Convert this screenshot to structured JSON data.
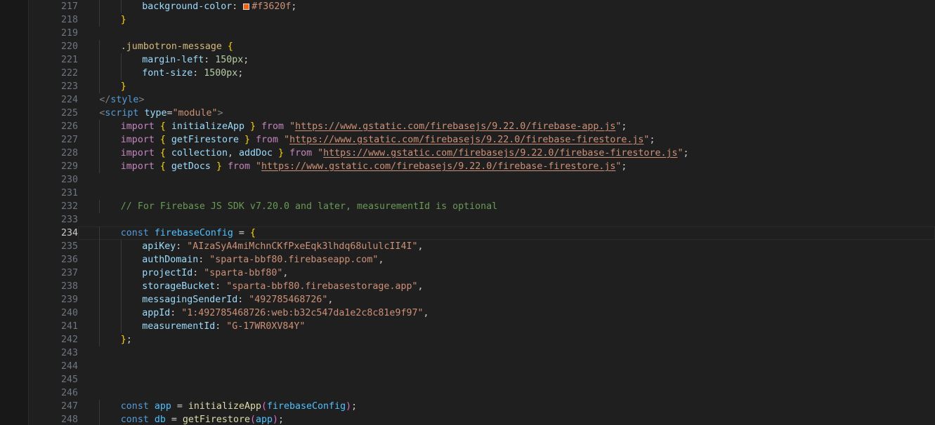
{
  "editor": {
    "active_line": 234,
    "color_swatch": "#f3620f",
    "lines": [
      {
        "num": 217,
        "indent": 3,
        "tokens": [
          [
            "tok-prop",
            "background-color"
          ],
          [
            "tok-plain",
            ": "
          ],
          [
            "swatch",
            ""
          ],
          [
            "tok-str",
            "#f3620f"
          ],
          [
            "tok-plain",
            ";"
          ]
        ]
      },
      {
        "num": 218,
        "indent": 2,
        "tokens": [
          [
            "tok-brace",
            "}"
          ]
        ]
      },
      {
        "num": 219,
        "indent": 0,
        "tokens": []
      },
      {
        "num": 220,
        "indent": 2,
        "tokens": [
          [
            "tok-sel",
            ".jumbotron-message"
          ],
          [
            "tok-plain",
            " "
          ],
          [
            "tok-brace",
            "{"
          ]
        ]
      },
      {
        "num": 221,
        "indent": 3,
        "tokens": [
          [
            "tok-prop",
            "margin-left"
          ],
          [
            "tok-plain",
            ": "
          ],
          [
            "tok-num",
            "150px"
          ],
          [
            "tok-plain",
            ";"
          ]
        ]
      },
      {
        "num": 222,
        "indent": 3,
        "tokens": [
          [
            "tok-prop",
            "font-size"
          ],
          [
            "tok-plain",
            ": "
          ],
          [
            "tok-num",
            "1500px"
          ],
          [
            "tok-plain",
            ";"
          ]
        ]
      },
      {
        "num": 223,
        "indent": 2,
        "tokens": [
          [
            "tok-brace",
            "}"
          ]
        ]
      },
      {
        "num": 224,
        "indent": 1,
        "tokens": [
          [
            "tok-punct",
            "</"
          ],
          [
            "tok-tag",
            "style"
          ],
          [
            "tok-punct",
            ">"
          ]
        ]
      },
      {
        "num": 225,
        "indent": 1,
        "tokens": [
          [
            "tok-punct",
            "<"
          ],
          [
            "tok-tag",
            "script"
          ],
          [
            "tok-plain",
            " "
          ],
          [
            "tok-attr",
            "type"
          ],
          [
            "tok-plain",
            "="
          ],
          [
            "tok-str",
            "\"module\""
          ],
          [
            "tok-punct",
            ">"
          ]
        ]
      },
      {
        "num": 226,
        "indent": 2,
        "tokens": [
          [
            "tok-kw",
            "import"
          ],
          [
            "tok-plain",
            " "
          ],
          [
            "tok-brace",
            "{"
          ],
          [
            "tok-plain",
            " "
          ],
          [
            "tok-var",
            "initializeApp"
          ],
          [
            "tok-plain",
            " "
          ],
          [
            "tok-brace",
            "}"
          ],
          [
            "tok-plain",
            " "
          ],
          [
            "tok-kw",
            "from"
          ],
          [
            "tok-plain",
            " "
          ],
          [
            "tok-str",
            "\""
          ],
          [
            "tok-url",
            "https://www.gstatic.com/firebasejs/9.22.0/firebase-app.js"
          ],
          [
            "tok-str",
            "\""
          ],
          [
            "tok-plain",
            ";"
          ]
        ]
      },
      {
        "num": 227,
        "indent": 2,
        "tokens": [
          [
            "tok-kw",
            "import"
          ],
          [
            "tok-plain",
            " "
          ],
          [
            "tok-brace",
            "{"
          ],
          [
            "tok-plain",
            " "
          ],
          [
            "tok-var",
            "getFirestore"
          ],
          [
            "tok-plain",
            " "
          ],
          [
            "tok-brace",
            "}"
          ],
          [
            "tok-plain",
            " "
          ],
          [
            "tok-kw",
            "from"
          ],
          [
            "tok-plain",
            " "
          ],
          [
            "tok-str",
            "\""
          ],
          [
            "tok-url",
            "https://www.gstatic.com/firebasejs/9.22.0/firebase-firestore.js"
          ],
          [
            "tok-str",
            "\""
          ],
          [
            "tok-plain",
            ";"
          ]
        ]
      },
      {
        "num": 228,
        "indent": 2,
        "tokens": [
          [
            "tok-kw",
            "import"
          ],
          [
            "tok-plain",
            " "
          ],
          [
            "tok-brace",
            "{"
          ],
          [
            "tok-plain",
            " "
          ],
          [
            "tok-var",
            "collection"
          ],
          [
            "tok-plain",
            ", "
          ],
          [
            "tok-var",
            "addDoc"
          ],
          [
            "tok-plain",
            " "
          ],
          [
            "tok-brace",
            "}"
          ],
          [
            "tok-plain",
            " "
          ],
          [
            "tok-kw",
            "from"
          ],
          [
            "tok-plain",
            " "
          ],
          [
            "tok-str",
            "\""
          ],
          [
            "tok-url",
            "https://www.gstatic.com/firebasejs/9.22.0/firebase-firestore.js"
          ],
          [
            "tok-str",
            "\""
          ],
          [
            "tok-plain",
            ";"
          ]
        ]
      },
      {
        "num": 229,
        "indent": 2,
        "tokens": [
          [
            "tok-kw",
            "import"
          ],
          [
            "tok-plain",
            " "
          ],
          [
            "tok-brace",
            "{"
          ],
          [
            "tok-plain",
            " "
          ],
          [
            "tok-var",
            "getDocs"
          ],
          [
            "tok-plain",
            " "
          ],
          [
            "tok-brace",
            "}"
          ],
          [
            "tok-plain",
            " "
          ],
          [
            "tok-kw",
            "from"
          ],
          [
            "tok-plain",
            " "
          ],
          [
            "tok-str",
            "\""
          ],
          [
            "tok-url",
            "https://www.gstatic.com/firebasejs/9.22.0/firebase-firestore.js"
          ],
          [
            "tok-str",
            "\""
          ],
          [
            "tok-plain",
            ";"
          ]
        ]
      },
      {
        "num": 230,
        "indent": 0,
        "tokens": []
      },
      {
        "num": 231,
        "indent": 0,
        "tokens": []
      },
      {
        "num": 232,
        "indent": 2,
        "tokens": [
          [
            "tok-comment",
            "// For Firebase JS SDK v7.20.0 and later, measurementId is optional"
          ]
        ]
      },
      {
        "num": 233,
        "indent": 0,
        "tokens": []
      },
      {
        "num": 234,
        "indent": 2,
        "tokens": [
          [
            "tok-decl",
            "const"
          ],
          [
            "tok-plain",
            " "
          ],
          [
            "tok-const",
            "firebaseConfig"
          ],
          [
            "tok-plain",
            " = "
          ],
          [
            "tok-brace",
            "{"
          ]
        ]
      },
      {
        "num": 235,
        "indent": 3,
        "tokens": [
          [
            "tok-prop",
            "apiKey"
          ],
          [
            "tok-plain",
            ": "
          ],
          [
            "tok-str",
            "\"AIzaSyA4miMchnCKfPxeEqk3lhdq68ululcII4I\""
          ],
          [
            "tok-plain",
            ","
          ]
        ]
      },
      {
        "num": 236,
        "indent": 3,
        "tokens": [
          [
            "tok-prop",
            "authDomain"
          ],
          [
            "tok-plain",
            ": "
          ],
          [
            "tok-str",
            "\"sparta-bbf80.firebaseapp.com\""
          ],
          [
            "tok-plain",
            ","
          ]
        ]
      },
      {
        "num": 237,
        "indent": 3,
        "tokens": [
          [
            "tok-prop",
            "projectId"
          ],
          [
            "tok-plain",
            ": "
          ],
          [
            "tok-str",
            "\"sparta-bbf80\""
          ],
          [
            "tok-plain",
            ","
          ]
        ]
      },
      {
        "num": 238,
        "indent": 3,
        "tokens": [
          [
            "tok-prop",
            "storageBucket"
          ],
          [
            "tok-plain",
            ": "
          ],
          [
            "tok-str",
            "\"sparta-bbf80.firebasestorage.app\""
          ],
          [
            "tok-plain",
            ","
          ]
        ]
      },
      {
        "num": 239,
        "indent": 3,
        "tokens": [
          [
            "tok-prop",
            "messagingSenderId"
          ],
          [
            "tok-plain",
            ": "
          ],
          [
            "tok-str",
            "\"492785468726\""
          ],
          [
            "tok-plain",
            ","
          ]
        ]
      },
      {
        "num": 240,
        "indent": 3,
        "tokens": [
          [
            "tok-prop",
            "appId"
          ],
          [
            "tok-plain",
            ": "
          ],
          [
            "tok-str",
            "\"1:492785468726:web:b32c547da1e2c8c81e9f97\""
          ],
          [
            "tok-plain",
            ","
          ]
        ]
      },
      {
        "num": 241,
        "indent": 3,
        "tokens": [
          [
            "tok-prop",
            "measurementId"
          ],
          [
            "tok-plain",
            ": "
          ],
          [
            "tok-str",
            "\"G-17WR0XV84Y\""
          ]
        ]
      },
      {
        "num": 242,
        "indent": 2,
        "tokens": [
          [
            "tok-brace",
            "}"
          ],
          [
            "tok-plain",
            ";"
          ]
        ]
      },
      {
        "num": 243,
        "indent": 0,
        "tokens": []
      },
      {
        "num": 244,
        "indent": 0,
        "tokens": []
      },
      {
        "num": 245,
        "indent": 0,
        "tokens": []
      },
      {
        "num": 246,
        "indent": 0,
        "tokens": []
      },
      {
        "num": 247,
        "indent": 2,
        "tokens": [
          [
            "tok-decl",
            "const"
          ],
          [
            "tok-plain",
            " "
          ],
          [
            "tok-const",
            "app"
          ],
          [
            "tok-plain",
            " = "
          ],
          [
            "tok-fn",
            "initializeApp"
          ],
          [
            "tok-brace2",
            "("
          ],
          [
            "tok-const",
            "firebaseConfig"
          ],
          [
            "tok-brace2",
            ")"
          ],
          [
            "tok-plain",
            ";"
          ]
        ]
      },
      {
        "num": 248,
        "indent": 2,
        "tokens": [
          [
            "tok-decl",
            "const"
          ],
          [
            "tok-plain",
            " "
          ],
          [
            "tok-const",
            "db"
          ],
          [
            "tok-plain",
            " = "
          ],
          [
            "tok-fn",
            "getFirestore"
          ],
          [
            "tok-brace2",
            "("
          ],
          [
            "tok-const",
            "app"
          ],
          [
            "tok-brace2",
            ")"
          ],
          [
            "tok-plain",
            ";"
          ]
        ]
      }
    ]
  }
}
